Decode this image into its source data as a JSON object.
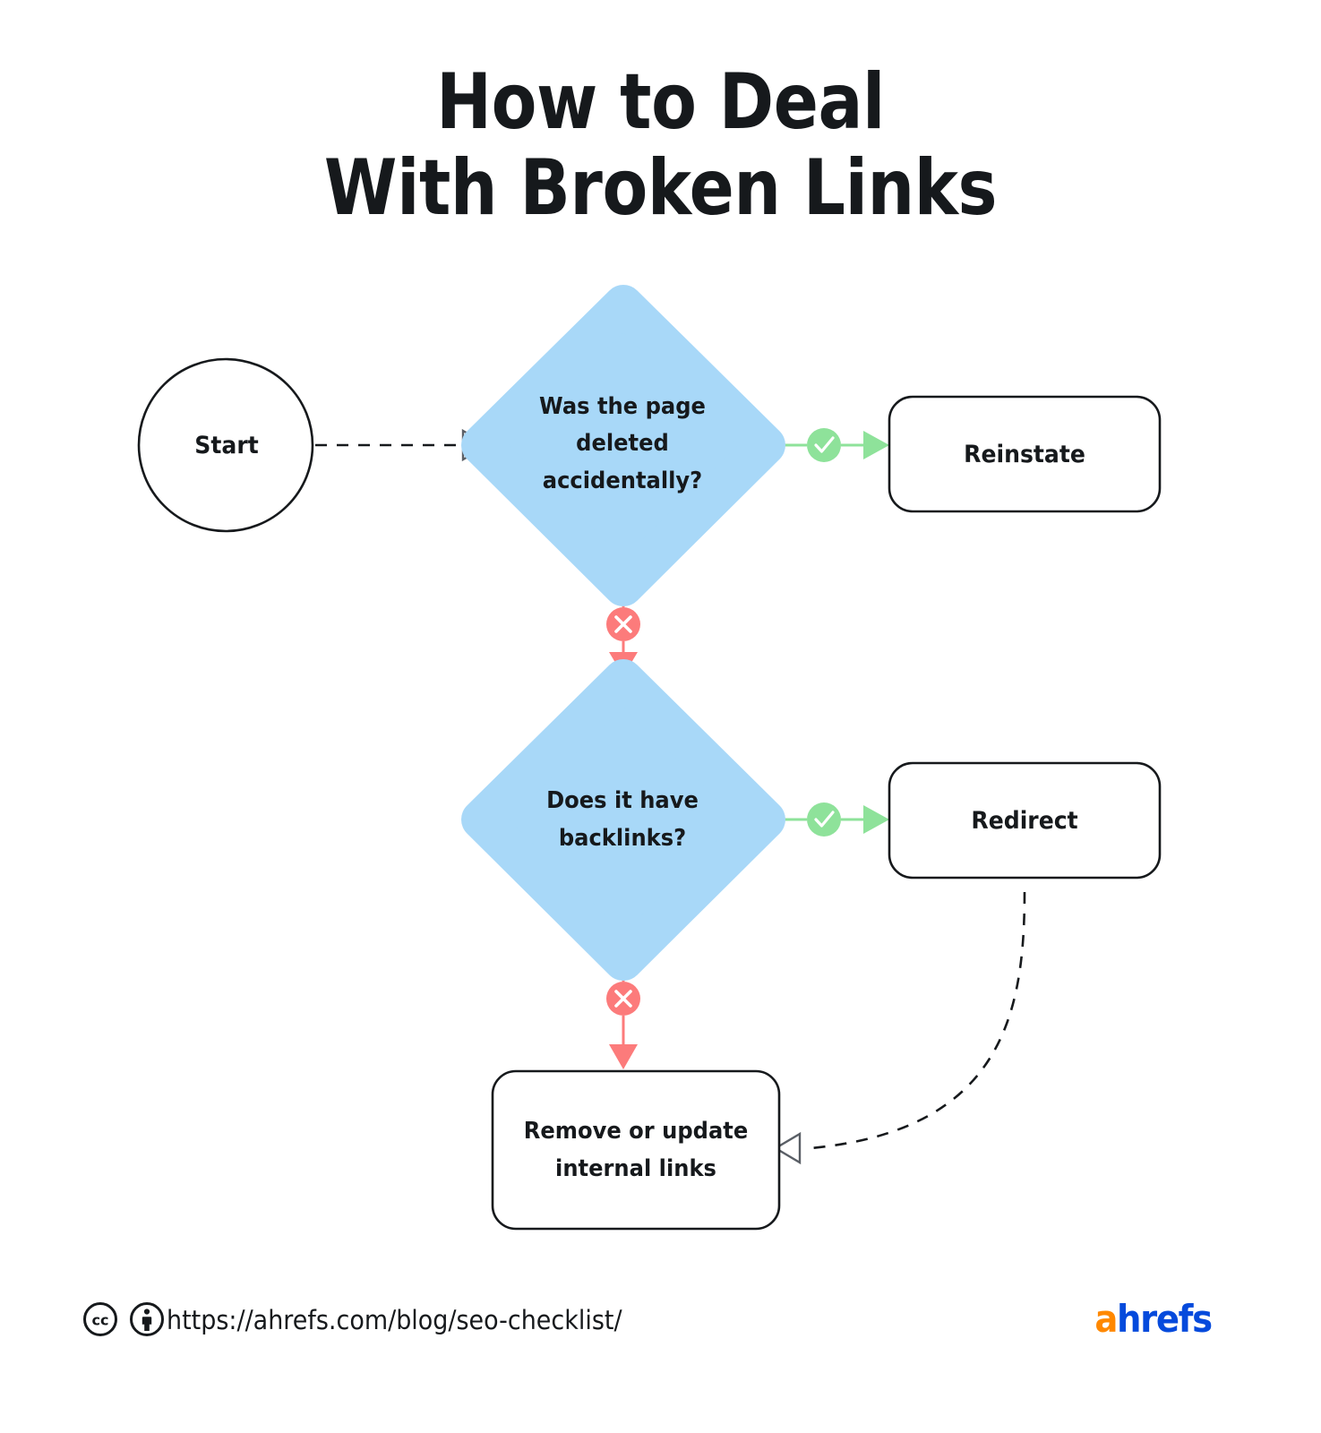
{
  "title": "How to Deal\nWith Broken Links",
  "colors": {
    "diamond_fill": "#a8d8f8",
    "yes_green": "#8ee29a",
    "no_red": "#fc7b7b",
    "node_stroke": "#16191c",
    "text": "#16191c",
    "brand_orange": "#ff8800",
    "brand_blue": "#054adc",
    "background": "#ffffff"
  },
  "flowchart": {
    "type": "flowchart",
    "nodes": [
      {
        "id": "start",
        "shape": "circle",
        "label": "Start"
      },
      {
        "id": "q1",
        "shape": "diamond",
        "label": "Was the page\ndeleted\naccidentally?"
      },
      {
        "id": "reinstate",
        "shape": "rounded-rectangle",
        "label": "Reinstate"
      },
      {
        "id": "q2",
        "shape": "diamond",
        "label": "Does it have\nbacklinks?"
      },
      {
        "id": "redirect",
        "shape": "rounded-rectangle",
        "label": "Redirect"
      },
      {
        "id": "remove",
        "shape": "rounded-rectangle",
        "label": "Remove or update\ninternal links"
      }
    ],
    "edges": [
      {
        "from": "start",
        "to": "q1",
        "style": "dashed",
        "arrow": "hollow-triangle",
        "badge": "none"
      },
      {
        "from": "q1",
        "to": "reinstate",
        "style": "solid",
        "arrow": "filled-triangle",
        "badge": "check",
        "badge_color": "#8ee29a"
      },
      {
        "from": "q1",
        "to": "q2",
        "style": "solid",
        "arrow": "filled-triangle",
        "badge": "cross",
        "badge_color": "#fc7b7b"
      },
      {
        "from": "q2",
        "to": "redirect",
        "style": "solid",
        "arrow": "filled-triangle",
        "badge": "check",
        "badge_color": "#8ee29a"
      },
      {
        "from": "q2",
        "to": "remove",
        "style": "solid",
        "arrow": "filled-triangle",
        "badge": "cross",
        "badge_color": "#fc7b7b"
      },
      {
        "from": "redirect",
        "to": "remove",
        "style": "dashed-curve",
        "arrow": "hollow-triangle",
        "badge": "none"
      }
    ]
  },
  "footer": {
    "license_icons": [
      "cc-icon",
      "cc-by-icon"
    ],
    "url": "https://ahrefs.com/blog/seo-checklist/",
    "brand_first": "a",
    "brand_rest": "hrefs"
  }
}
